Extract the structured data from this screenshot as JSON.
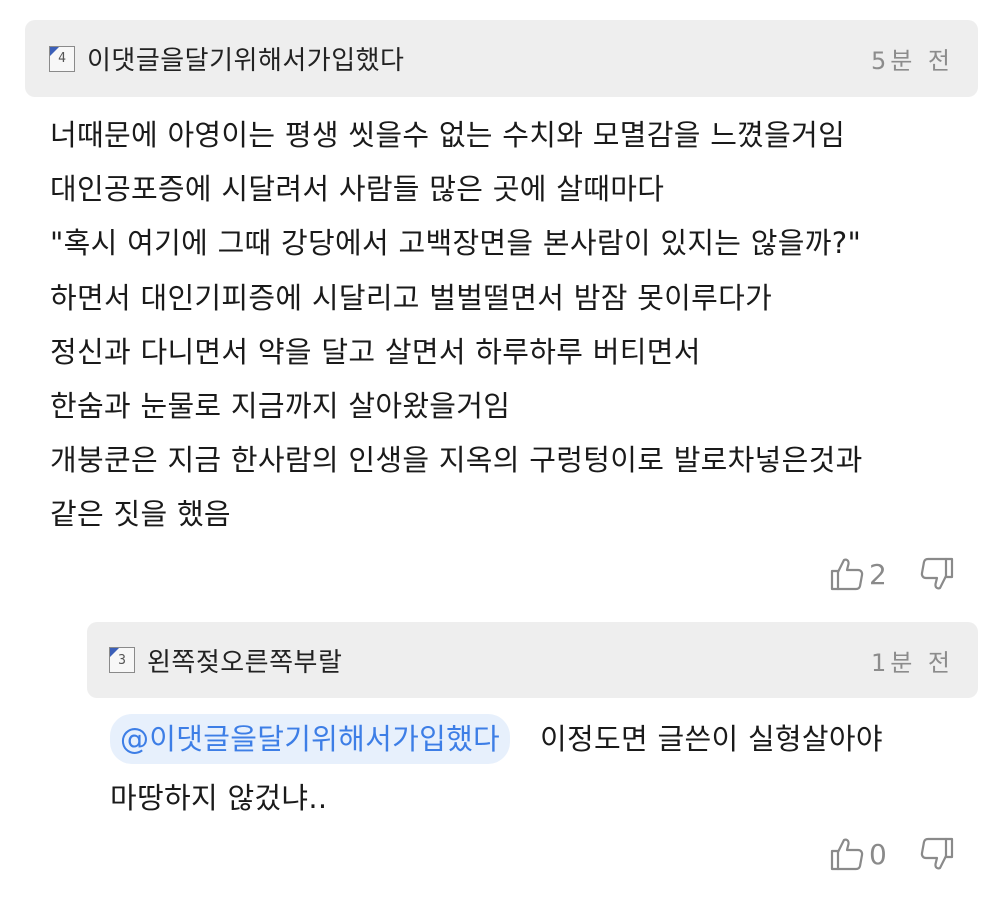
{
  "comments": [
    {
      "level_badge": "4",
      "username": "이댓글을달기위해서가입했다",
      "time": "5분 전",
      "lines": [
        "너때문에 아영이는 평생 씻을수 없는 수치와 모멸감을 느꼈을거임",
        "대인공포증에 시달려서 사람들 많은 곳에 살때마다",
        "\"혹시 여기에 그때 강당에서 고백장면을 본사람이 있지는 않을까?\"",
        "하면서 대인기피증에 시달리고 벌벌떨면서 밤잠 못이루다가",
        "정신과 다니면서 약을 달고 살면서 하루하루 버티면서",
        "한숨과 눈물로 지금까지 살아왔을거임",
        "개붕쿤은 지금 한사람의 인생을 지옥의 구렁텅이로 발로차넣은것과",
        "같은 짓을 했음"
      ],
      "likes": "2",
      "like_icon": "thumbs-up-outline",
      "dislike_icon": "thumbs-down-outline"
    },
    {
      "level_badge": "3",
      "username": "왼쪽젖오른쪽부랄",
      "time": "1분 전",
      "mention": "@이댓글을달기위해서가입했다",
      "line1_rest": "이정도면 글쓴이 실형살아야",
      "line2": "마땅하지 않겄냐..",
      "likes": "0",
      "like_icon": "thumbs-up-outline",
      "dislike_icon": "thumbs-down-outline"
    }
  ],
  "colors": {
    "header_bg": "#eeeeee",
    "mention_bg": "#e7f0fc",
    "mention_text": "#3d7ee6",
    "muted": "#8c8c8c",
    "badge_accent": "#3b5fb8"
  }
}
